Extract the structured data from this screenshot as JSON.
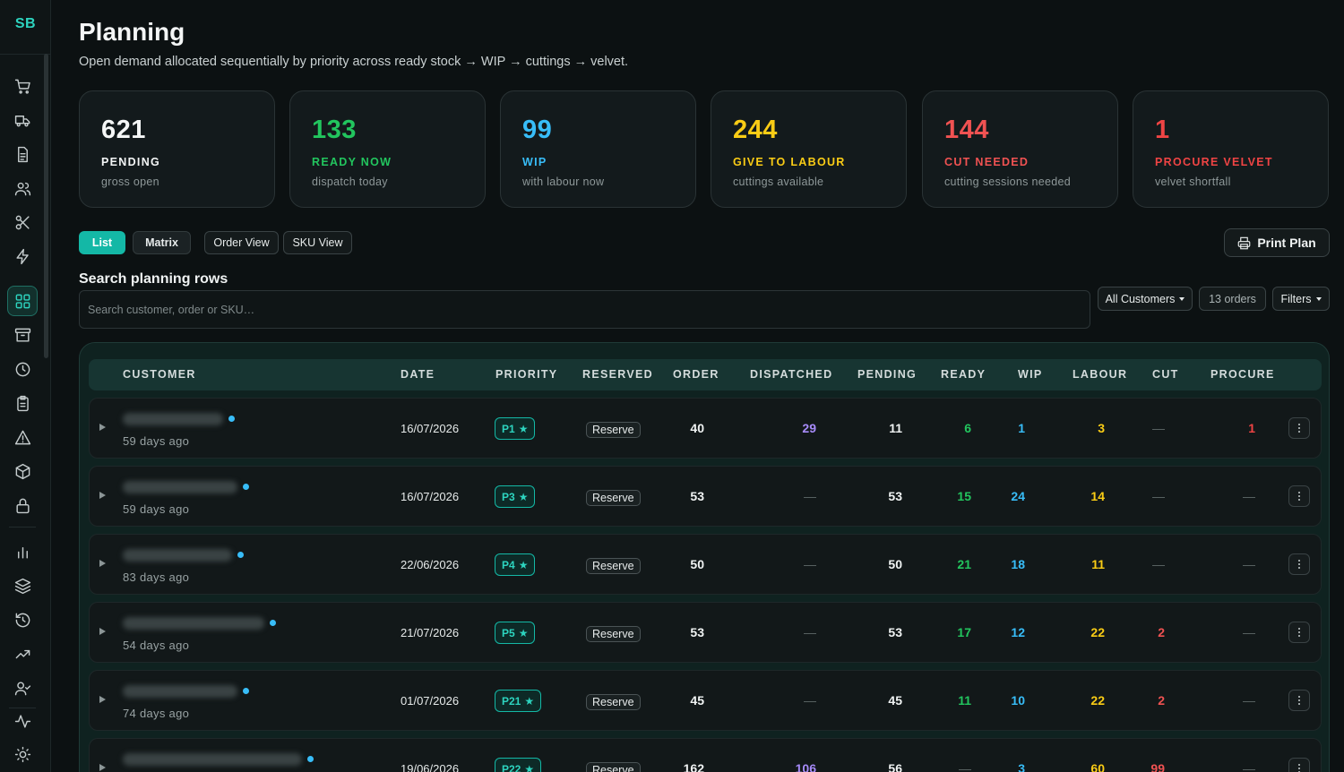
{
  "app": {
    "logo": "SB"
  },
  "header": {
    "title": "Planning",
    "subtitle": "Open demand allocated sequentially by priority across ready stock → WIP → cuttings → velvet."
  },
  "kpis": [
    {
      "value": "621",
      "label": "PENDING",
      "desc": "gross open",
      "color": "#f4f6f6"
    },
    {
      "value": "133",
      "label": "READY NOW",
      "desc": "dispatch today",
      "color": "#22c55e"
    },
    {
      "value": "99",
      "label": "WIP",
      "desc": "with labour now",
      "color": "#38bdf8"
    },
    {
      "value": "244",
      "label": "GIVE TO LABOUR",
      "desc": "cuttings available",
      "color": "#facc15"
    },
    {
      "value": "144",
      "label": "CUT NEEDED",
      "desc": "cutting sessions needed",
      "color": "#f05252"
    },
    {
      "value": "1",
      "label": "PROCURE VELVET",
      "desc": "velvet shortfall",
      "color": "#ef4444"
    }
  ],
  "view_tabs": {
    "list": "List",
    "matrix": "Matrix",
    "order_view": "Order View",
    "sku_view": "SKU View"
  },
  "actions": {
    "print": "Print Plan"
  },
  "search": {
    "label": "Search planning rows",
    "placeholder": "Search customer, order or SKU…",
    "customers_filter": "All Customers",
    "order_count": "13 orders",
    "filters": "Filters"
  },
  "table": {
    "columns": {
      "customer": "CUSTOMER",
      "date": "DATE",
      "priority": "PRIORITY",
      "reserved": "RESERVED",
      "order": "ORDER",
      "dispatched": "DISPATCHED",
      "pending": "PENDING",
      "ready": "READY",
      "wip": "WIP",
      "labour": "LABOUR",
      "cut": "CUT",
      "procure": "PROCURE"
    },
    "reserve_label": "Reserve",
    "rows": [
      {
        "age": "59 days ago",
        "date": "16/07/2026",
        "priority": "P1",
        "order": "40",
        "dispatched": "29",
        "pending": "11",
        "ready": "6",
        "wip": "1",
        "labour": "3",
        "cut": "—",
        "procure": "1"
      },
      {
        "age": "59 days ago",
        "date": "16/07/2026",
        "priority": "P3",
        "order": "53",
        "dispatched": "—",
        "pending": "53",
        "ready": "15",
        "wip": "24",
        "labour": "14",
        "cut": "—",
        "procure": "—"
      },
      {
        "age": "83 days ago",
        "date": "22/06/2026",
        "priority": "P4",
        "order": "50",
        "dispatched": "—",
        "pending": "50",
        "ready": "21",
        "wip": "18",
        "labour": "11",
        "cut": "—",
        "procure": "—"
      },
      {
        "age": "54 days ago",
        "date": "21/07/2026",
        "priority": "P5",
        "order": "53",
        "dispatched": "—",
        "pending": "53",
        "ready": "17",
        "wip": "12",
        "labour": "22",
        "cut": "2",
        "procure": "—"
      },
      {
        "age": "74 days ago",
        "date": "01/07/2026",
        "priority": "P21",
        "order": "45",
        "dispatched": "—",
        "pending": "45",
        "ready": "11",
        "wip": "10",
        "labour": "22",
        "cut": "2",
        "procure": "—"
      },
      {
        "age": "",
        "date": "19/06/2026",
        "priority": "P22",
        "order": "162",
        "dispatched": "106",
        "pending": "56",
        "ready": "—",
        "wip": "3",
        "labour": "60",
        "cut": "99",
        "procure": "—"
      }
    ]
  },
  "colors": {
    "accent": "#14b8a6",
    "ready": "#22c55e",
    "wip": "#38bdf8",
    "labour": "#facc15",
    "cut": "#f05252",
    "procure": "#ef4444",
    "dispatched": "#a78bfa"
  }
}
